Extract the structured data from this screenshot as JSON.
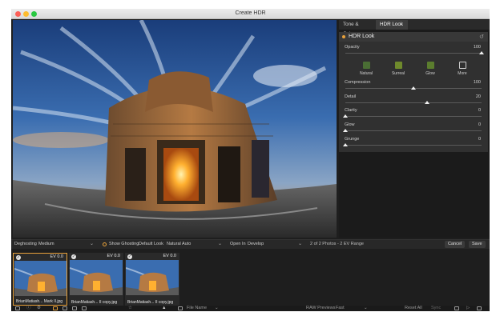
{
  "window": {
    "title": "Create HDR"
  },
  "panel": {
    "tabs": [
      "Tone & Color",
      "HDR Look"
    ],
    "section_title": "HDR Look",
    "opacity": {
      "label": "Opacity",
      "value": "100",
      "level": 1.0
    },
    "presets": [
      {
        "label": "Natural",
        "color": "#4a6e34"
      },
      {
        "label": "Surreal",
        "color": "#6f8a2c"
      },
      {
        "label": "Glow",
        "color": "#5b7d2e"
      },
      {
        "label": "More",
        "color": "#666666"
      }
    ],
    "sliders": [
      {
        "label": "Compression",
        "value": "100",
        "level": 0.5
      },
      {
        "label": "Detail",
        "value": "20",
        "level": 0.6
      },
      {
        "label": "Clarity",
        "value": "0",
        "level": 0.0
      },
      {
        "label": "Glow",
        "value": "0",
        "level": 0.0
      },
      {
        "label": "Grunge",
        "value": "0",
        "level": 0.0
      }
    ]
  },
  "toolbar": {
    "deghosting_label": "Deghosting",
    "deghosting_value": "Medium",
    "show_ghosting": "Show Ghosting",
    "look_label": "Default Look",
    "look_value": "Natural Auto",
    "open_in_label": "Open In",
    "open_in_value": "Develop",
    "photo_count": "2 of 2 Photos - 2 EV Range",
    "cancel": "Cancel",
    "save": "Save"
  },
  "filmstrip": [
    {
      "ev": "EV 0.0",
      "name": "BrianMatiash... Mark II.jpg",
      "selected": true
    },
    {
      "ev": "EV 0.0",
      "name": "BrianMatiash... II copy.jpg",
      "selected": false
    },
    {
      "ev": "EV 0.0",
      "name": "BrianMatiash... II copy.jpg",
      "selected": false
    }
  ],
  "status": {
    "sort_label": "File Name",
    "raw_label": "RAW Previews",
    "raw_value": "Fast",
    "reset_all": "Reset All",
    "sync": "Sync"
  },
  "colors": {
    "accent": "#e8a13a",
    "panel": "#303030",
    "background": "#1e1e1e"
  }
}
